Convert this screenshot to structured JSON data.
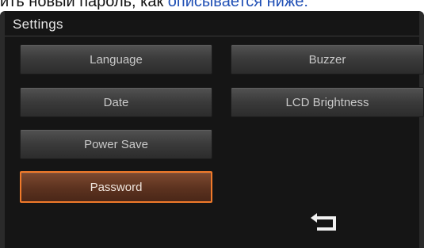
{
  "caption": {
    "text_before": "ить новый пароль, как",
    "text_link": " описывается ниже:"
  },
  "screen": {
    "title": "Settings",
    "buttons": {
      "language": "Language",
      "date": "Date",
      "power_save": "Power Save",
      "password": "Password",
      "buzzer": "Buzzer",
      "lcd_brightness": "LCD Brightness"
    },
    "selected": "password",
    "back_icon": "return-arrow-icon"
  },
  "colors": {
    "accent": "#f07a2a",
    "background": "#151515"
  }
}
